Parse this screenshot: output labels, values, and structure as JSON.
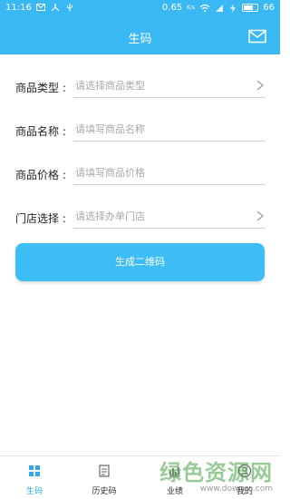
{
  "status_bar": {
    "time": "11:16",
    "net_speed": "0.65",
    "net_unit": "K/s",
    "battery_level": 66,
    "battery_text": "66"
  },
  "header": {
    "title": "生码",
    "mail_icon": "mail-icon"
  },
  "form": {
    "fields": [
      {
        "label": "商品类型 :",
        "placeholder": "请选择商品类型",
        "has_chevron": true
      },
      {
        "label": "商品名称 :",
        "placeholder": "请填写商品名称",
        "has_chevron": false
      },
      {
        "label": "商品价格 :",
        "placeholder": "请填写商品价格",
        "has_chevron": false
      },
      {
        "label": "门店选择 :",
        "placeholder": "请选择办单门店",
        "has_chevron": true
      }
    ]
  },
  "generate_button": {
    "label": "生成二维码"
  },
  "tabbar": {
    "tabs": [
      {
        "label": "生码",
        "icon": "grid-icon",
        "active": true
      },
      {
        "label": "历史码",
        "icon": "history-icon",
        "active": false
      },
      {
        "label": "业绩",
        "icon": "chart-icon",
        "active": false
      },
      {
        "label": "我的",
        "icon": "profile-icon",
        "active": false
      }
    ]
  },
  "watermark": {
    "main": "绿色资源网",
    "sub": "www.downcc.com"
  },
  "colors": {
    "primary": "#39b8f3",
    "button": "#3dbdf5",
    "active_tab": "#2ea9ea"
  }
}
